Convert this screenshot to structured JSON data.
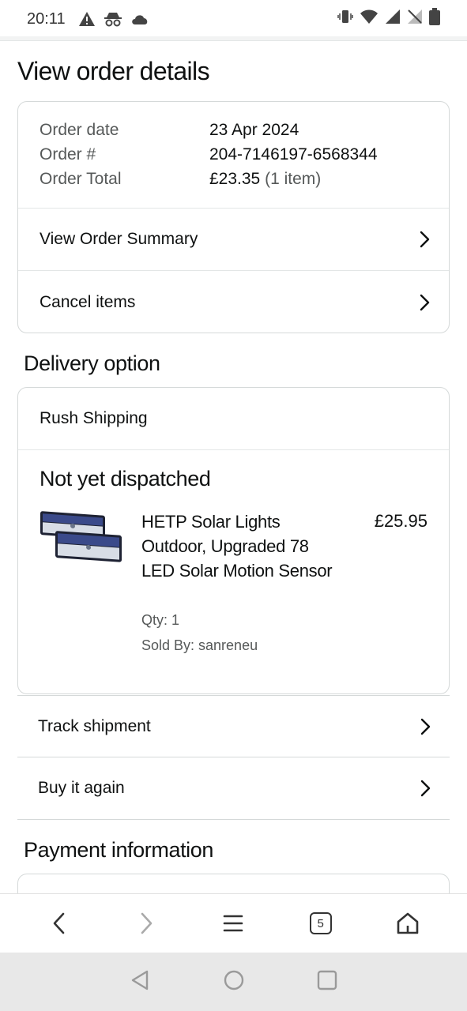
{
  "status_bar": {
    "time": "20:11",
    "tab_count": "5"
  },
  "page": {
    "title": "View order details"
  },
  "order": {
    "date_label": "Order date",
    "date_value": "23 Apr 2024",
    "number_label": "Order #",
    "number_value": "204-7146197-6568344",
    "total_label": "Order Total",
    "total_value": "£23.35",
    "total_items": "(1 item)",
    "summary_link": "View Order Summary",
    "cancel_link": "Cancel items"
  },
  "delivery": {
    "heading": "Delivery option",
    "method": "Rush Shipping",
    "status": "Not yet dispatched",
    "product": {
      "name": "HETP Solar Lights Outdoor, Upgraded 78 LED Solar Motion Sensor",
      "price": "£25.95",
      "qty": "Qty: 1",
      "seller": "Sold By: sanreneu"
    },
    "track_link": "Track shipment",
    "buy_again_link": "Buy it again"
  },
  "payment": {
    "heading": "Payment information"
  }
}
